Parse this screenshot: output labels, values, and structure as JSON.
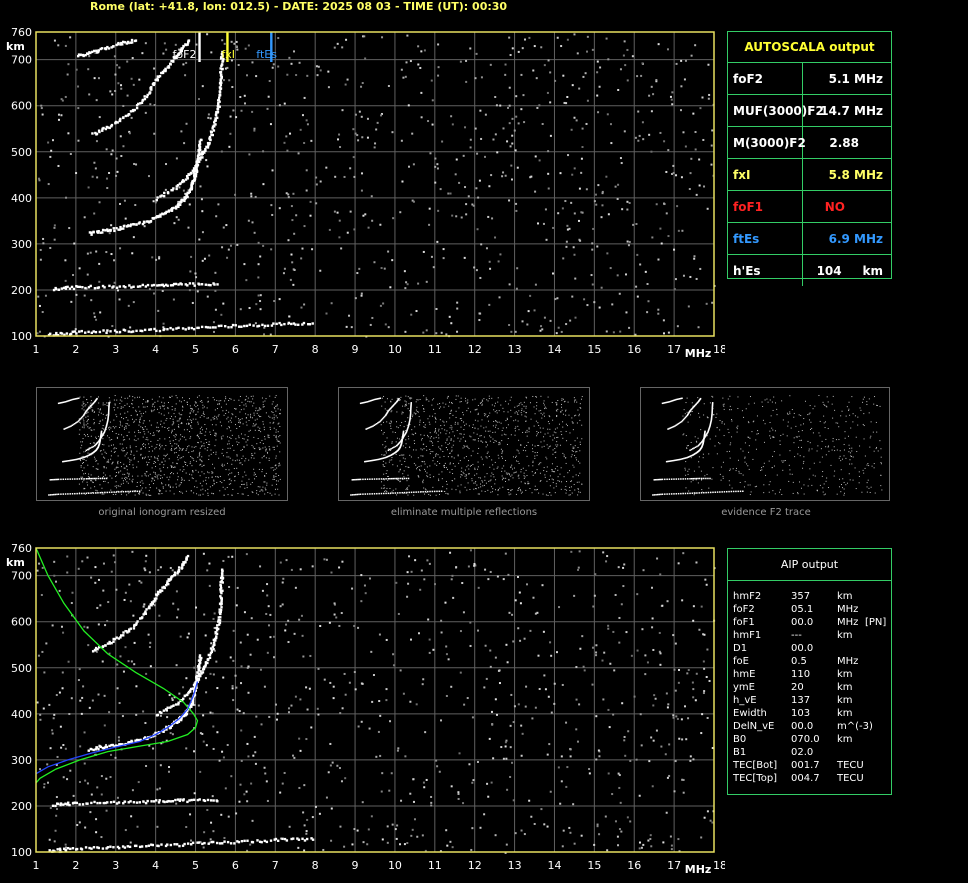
{
  "header": {
    "station_line": "Rome (lat: +41.8, lon: 012.5) - DATE: 2025 08 03 - TIME (UT): 00:30"
  },
  "colors": {
    "axis": "#e8e060",
    "grid": "#606060",
    "panel_border": "#33cc66",
    "foF2_marker": "#ffffff",
    "fxI_marker": "#ffff33",
    "ftEs_marker": "#3399ff",
    "profile_green": "#22ee22",
    "profile_blue": "#2244ff",
    "label_white": "#ffffff",
    "label_yellow": "#ffff66",
    "label_red": "#ff2222",
    "label_blue": "#3399ff"
  },
  "chart_data": [
    {
      "id": "top-ionogram",
      "type": "scatter",
      "xlabel": "MHz",
      "ylabel": "km",
      "xlim": [
        1,
        18
      ],
      "ylim": [
        100,
        760
      ],
      "xticks": [
        1,
        2,
        3,
        4,
        5,
        6,
        7,
        8,
        9,
        10,
        11,
        12,
        13,
        14,
        15,
        16,
        17,
        18
      ],
      "yticks": [
        100,
        200,
        300,
        400,
        500,
        600,
        700,
        760
      ],
      "grid": true,
      "markers": [
        {
          "label": "foF2",
          "freq": 5.1,
          "color_key": "foF2_marker"
        },
        {
          "label": "fxI",
          "freq": 5.8,
          "color_key": "fxI_marker"
        },
        {
          "label": "ftEs",
          "freq": 6.9,
          "color_key": "ftEs_marker"
        }
      ],
      "traces": [
        {
          "name": "",
          "points": [
            [
              2.3,
              325
            ],
            [
              2.8,
              332
            ],
            [
              3.3,
              340
            ],
            [
              3.8,
              352
            ],
            [
              4.2,
              368
            ],
            [
              4.5,
              385
            ],
            [
              4.7,
              400
            ],
            [
              4.85,
              420
            ],
            [
              4.95,
              445
            ],
            [
              5.0,
              470
            ],
            [
              5.05,
              500
            ],
            [
              5.1,
              530
            ]
          ]
        },
        {
          "name": "",
          "points": [
            [
              4.0,
              400
            ],
            [
              4.6,
              430
            ],
            [
              4.9,
              460
            ],
            [
              5.1,
              490
            ],
            [
              5.3,
              520
            ],
            [
              5.45,
              560
            ],
            [
              5.55,
              600
            ],
            [
              5.6,
              640
            ],
            [
              5.62,
              680
            ],
            [
              5.65,
              720
            ]
          ]
        },
        {
          "name": "",
          "points": [
            [
              2.4,
              540
            ],
            [
              2.9,
              560
            ],
            [
              3.4,
              590
            ],
            [
              3.8,
              630
            ],
            [
              4.0,
              660
            ],
            [
              4.3,
              690
            ],
            [
              4.6,
              720
            ],
            [
              4.8,
              745
            ]
          ]
        },
        {
          "name": "",
          "points": [
            [
              2.0,
              710
            ],
            [
              2.5,
              720
            ],
            [
              3.0,
              735
            ],
            [
              3.5,
              745
            ]
          ]
        },
        {
          "name": "",
          "points": [
            [
              1.4,
              205
            ],
            [
              2.0,
              208
            ],
            [
              3.0,
              210
            ],
            [
              4.0,
              212
            ],
            [
              4.7,
              214
            ],
            [
              5.6,
              214
            ]
          ]
        },
        {
          "name": "",
          "points": [
            [
              1.3,
              105
            ],
            [
              2.0,
              110
            ],
            [
              3.0,
              113
            ],
            [
              4.0,
              116
            ],
            [
              5.0,
              120
            ],
            [
              6.0,
              124
            ],
            [
              7.0,
              128
            ],
            [
              8.0,
              130
            ]
          ]
        }
      ]
    },
    {
      "id": "bottom-ionogram",
      "type": "scatter",
      "xlabel": "MHz",
      "ylabel": "km",
      "xlim": [
        1,
        18
      ],
      "ylim": [
        100,
        760
      ],
      "xticks": [
        1,
        2,
        3,
        4,
        5,
        6,
        7,
        8,
        9,
        10,
        11,
        12,
        13,
        14,
        15,
        16,
        17,
        18
      ],
      "yticks": [
        100,
        200,
        300,
        400,
        500,
        600,
        700,
        760
      ],
      "grid": true,
      "traces": [
        {
          "name": "",
          "points": [
            [
              2.3,
              325
            ],
            [
              2.8,
              332
            ],
            [
              3.3,
              340
            ],
            [
              3.8,
              352
            ],
            [
              4.2,
              368
            ],
            [
              4.5,
              385
            ],
            [
              4.7,
              400
            ],
            [
              4.85,
              420
            ],
            [
              4.95,
              445
            ],
            [
              5.0,
              470
            ],
            [
              5.05,
              500
            ],
            [
              5.1,
              530
            ]
          ]
        },
        {
          "name": "",
          "points": [
            [
              4.0,
              400
            ],
            [
              4.6,
              430
            ],
            [
              4.9,
              460
            ],
            [
              5.1,
              490
            ],
            [
              5.3,
              520
            ],
            [
              5.45,
              560
            ],
            [
              5.55,
              600
            ],
            [
              5.6,
              640
            ],
            [
              5.62,
              680
            ],
            [
              5.65,
              720
            ]
          ]
        },
        {
          "name": "",
          "points": [
            [
              2.4,
              540
            ],
            [
              2.9,
              560
            ],
            [
              3.4,
              590
            ],
            [
              3.8,
              630
            ],
            [
              4.0,
              660
            ],
            [
              4.3,
              690
            ],
            [
              4.6,
              720
            ],
            [
              4.8,
              745
            ]
          ]
        },
        {
          "name": "",
          "points": [
            [
              1.4,
              205
            ],
            [
              2.0,
              208
            ],
            [
              3.0,
              210
            ],
            [
              4.0,
              212
            ],
            [
              4.7,
              214
            ],
            [
              5.6,
              214
            ]
          ]
        },
        {
          "name": "",
          "points": [
            [
              1.3,
              105
            ],
            [
              2.0,
              110
            ],
            [
              3.0,
              113
            ],
            [
              4.0,
              116
            ],
            [
              5.0,
              120
            ],
            [
              6.0,
              124
            ],
            [
              7.0,
              128
            ],
            [
              8.0,
              130
            ]
          ]
        }
      ],
      "profiles": [
        {
          "name": "",
          "color_key": "profile_green",
          "points": [
            [
              1.0,
              760
            ],
            [
              1.3,
              700
            ],
            [
              1.7,
              640
            ],
            [
              2.2,
              580
            ],
            [
              2.8,
              530
            ],
            [
              3.5,
              490
            ],
            [
              4.2,
              455
            ],
            [
              4.7,
              425
            ],
            [
              4.95,
              400
            ],
            [
              5.05,
              385
            ],
            [
              5.0,
              370
            ],
            [
              4.8,
              355
            ],
            [
              4.3,
              340
            ],
            [
              3.6,
              330
            ],
            [
              2.8,
              318
            ],
            [
              2.1,
              300
            ],
            [
              1.5,
              280
            ],
            [
              1.1,
              260
            ],
            [
              1.0,
              250
            ]
          ]
        },
        {
          "name": "",
          "color_key": "profile_blue",
          "points": [
            [
              1.0,
              270
            ],
            [
              1.3,
              285
            ],
            [
              1.8,
              300
            ],
            [
              2.4,
              315
            ],
            [
              3.0,
              328
            ],
            [
              3.6,
              340
            ],
            [
              4.0,
              355
            ],
            [
              4.3,
              370
            ],
            [
              4.6,
              390
            ],
            [
              4.8,
              410
            ],
            [
              4.95,
              440
            ],
            [
              5.05,
              470
            ]
          ]
        }
      ]
    }
  ],
  "thumbnails": [
    {
      "caption": "original ionogram resized"
    },
    {
      "caption": "eliminate multiple reflections"
    },
    {
      "caption": "evidence F2 trace"
    }
  ],
  "autoscala": {
    "title": "AUTOSCALA output",
    "rows": [
      {
        "label": "foF2",
        "value": "5.1 MHz",
        "color_key": "label_white"
      },
      {
        "label": "MUF(3000)F2",
        "value": "14.7 MHz",
        "color_key": "label_white"
      },
      {
        "label": "M(3000)F2",
        "value": "2.88",
        "color_key": "label_white"
      },
      {
        "label": "fxI",
        "value": "5.8 MHz",
        "color_key": "label_yellow"
      },
      {
        "label": "foF1",
        "value": "NO",
        "color_key": "label_red"
      },
      {
        "label": "ftEs",
        "value": "6.9 MHz",
        "color_key": "label_blue"
      },
      {
        "label": "h'Es",
        "value": "104     km",
        "color_key": "label_white"
      }
    ]
  },
  "aip": {
    "title": "AIP output",
    "rows": [
      {
        "param": "hmF2",
        "value": "357",
        "unit": "km",
        "extra": ""
      },
      {
        "param": "foF2",
        "value": "05.1",
        "unit": "MHz",
        "extra": ""
      },
      {
        "param": "foF1",
        "value": "00.0",
        "unit": "MHz",
        "extra": "[PN]"
      },
      {
        "param": "hmF1",
        "value": "---",
        "unit": "km",
        "extra": ""
      },
      {
        "param": "D1",
        "value": "00.0",
        "unit": "",
        "extra": ""
      },
      {
        "param": "foE",
        "value": "0.5",
        "unit": "MHz",
        "extra": ""
      },
      {
        "param": "hmE",
        "value": "110",
        "unit": "km",
        "extra": ""
      },
      {
        "param": "ymE",
        "value": "20",
        "unit": "km",
        "extra": ""
      },
      {
        "param": "h_vE",
        "value": "137",
        "unit": "km",
        "extra": ""
      },
      {
        "param": "Ewidth",
        "value": "103",
        "unit": "km",
        "extra": ""
      },
      {
        "param": "DelN_vE",
        "value": "00.0",
        "unit": "m^(-3)",
        "extra": ""
      },
      {
        "param": "B0",
        "value": "070.0",
        "unit": "km",
        "extra": ""
      },
      {
        "param": "B1",
        "value": "02.0",
        "unit": "",
        "extra": ""
      },
      {
        "param": "TEC[Bot]",
        "value": "001.7",
        "unit": "TECU",
        "extra": ""
      },
      {
        "param": "TEC[Top]",
        "value": "004.7",
        "unit": "TECU",
        "extra": ""
      }
    ]
  }
}
